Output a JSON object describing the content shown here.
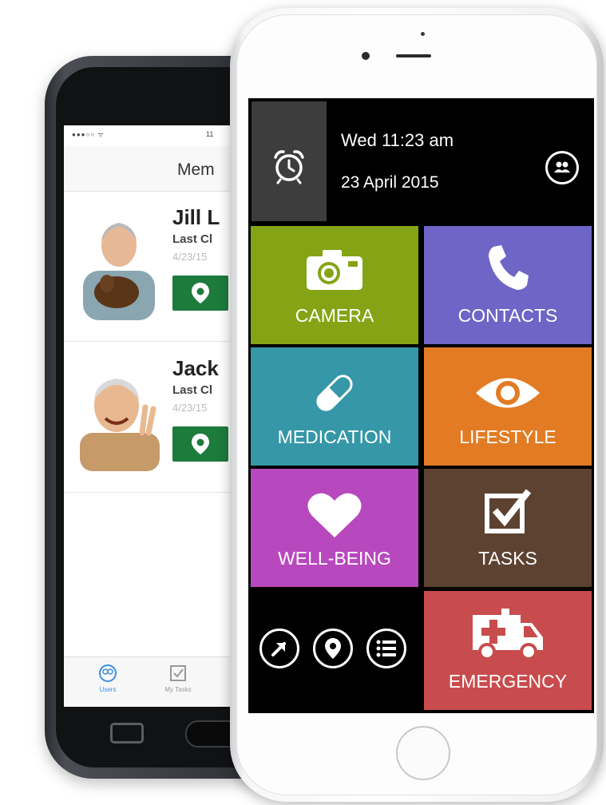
{
  "back_phone": {
    "status": {
      "time": "11"
    },
    "nav": {
      "title": "Mem"
    },
    "members": [
      {
        "name": "Jill L",
        "last": "Last Cl",
        "date": "4/23/15"
      },
      {
        "name": "Jack",
        "last": "Last Cl",
        "date": "4/23/15"
      }
    ],
    "tabbar": {
      "users_label": "Users",
      "tasks_label": "My Tasks",
      "users_icon": "users-icon",
      "tasks_icon": "checkbox-icon"
    }
  },
  "front_phone": {
    "header": {
      "time": "Wed 11:23 am",
      "date": "23 April 2015",
      "alarm_icon": "alarm-clock-icon",
      "profile_icon": "users-icon"
    },
    "tiles": {
      "camera": {
        "label": "CAMERA",
        "color": "#85a415",
        "icon": "camera-icon"
      },
      "contacts": {
        "label": "CONTACTS",
        "color": "#6e65c6",
        "icon": "phone-icon"
      },
      "medication": {
        "label": "MEDICATION",
        "color": "#3597a7",
        "icon": "pill-icon"
      },
      "lifestyle": {
        "label": "LIFESTYLE",
        "color": "#e27b23",
        "icon": "eye-icon"
      },
      "wellbeing": {
        "label": "WELL-BEING",
        "color": "#b848be",
        "icon": "heart-icon"
      },
      "tasks": {
        "label": "TASKS",
        "color": "#5d4232",
        "icon": "checkbox-icon"
      },
      "emergency": {
        "label": "EMERGENCY",
        "color": "#c84c4d",
        "icon": "ambulance-icon"
      }
    },
    "nav_buttons": [
      "arrow-icon",
      "location-pin-icon",
      "list-icon"
    ]
  }
}
